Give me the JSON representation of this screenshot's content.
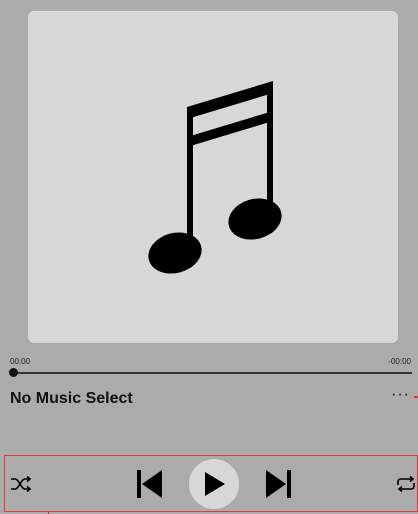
{
  "player": {
    "elapsed": "00:00",
    "remaining": "-00:00",
    "progress": 0,
    "track_title": "No Music Select",
    "more_label": "···"
  },
  "icons": {
    "artwork": "music-note-icon",
    "shuffle": "shuffle-icon",
    "previous": "previous-icon",
    "play": "play-icon",
    "next": "next-icon",
    "repeat": "repeat-icon"
  },
  "colors": {
    "background": "#ababab",
    "artwork_bg": "#d6d7d6",
    "accent_border": "#e13b3b"
  }
}
